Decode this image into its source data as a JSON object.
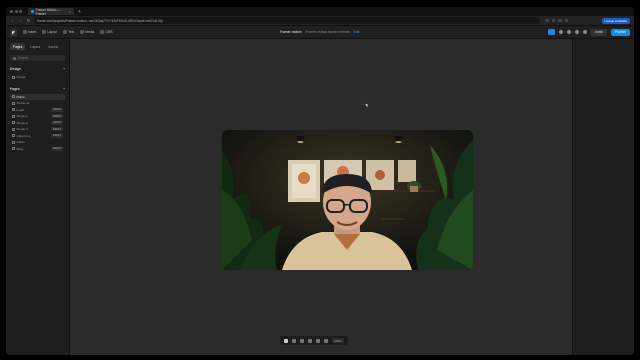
{
  "browser": {
    "tab_title": "Framer Motion — Framer",
    "url": "framer.com/projects/Framer-motion--mnGKGapTY1Yk2hFDKb0-dRXz?node=mkTwD1Sp",
    "update_label": "Update Available"
  },
  "toolbar": {
    "items": [
      {
        "label": "Insert",
        "icon": "plus-icon"
      },
      {
        "label": "Layout",
        "icon": "layout-icon"
      },
      {
        "label": "Text",
        "icon": "text-icon"
      },
      {
        "label": "Media",
        "icon": "image-icon"
      },
      {
        "label": "CMS",
        "icon": "database-icon"
      }
    ],
    "project_name": "Framer-motion",
    "project_status": "Framer-motion.framer.website",
    "project_badge": "Edit",
    "invite_label": "Invite",
    "publish_label": "Publish"
  },
  "sidebar": {
    "tabs": [
      "Pages",
      "Layers",
      "Assets"
    ],
    "active_tab": "Pages",
    "search_placeholder": "Search...",
    "design_heading": "Design",
    "design_items": [
      "Design"
    ],
    "pages_heading": "Pages",
    "pages": [
      {
        "label": "Home",
        "tag": "",
        "active": true
      },
      {
        "label": "Thank-ok",
        "tag": "",
        "active": false
      },
      {
        "label": "Legal",
        "tag": "DRAFT",
        "active": false
      },
      {
        "label": "Single-1",
        "tag": "DRAFT",
        "active": false
      },
      {
        "label": "Single-2",
        "tag": "DRAFT",
        "active": false
      },
      {
        "label": "Single-3",
        "tag": "DRAFT",
        "active": false
      },
      {
        "label": "Upcoming",
        "tag": "DRAFT",
        "active": false
      },
      {
        "label": "Cards",
        "tag": "",
        "active": false
      },
      {
        "label": "Blog",
        "tag": "DRAFT",
        "active": false
      }
    ]
  },
  "dock": {
    "tools": [
      "select-icon",
      "hand-icon",
      "comment-icon",
      "frame-icon",
      "settings-icon",
      "preview-icon"
    ],
    "zoom": "100%"
  },
  "colors": {
    "accent": "#0d8bf0",
    "canvas": "#2b2b2b",
    "panel": "#1e1e1e"
  }
}
